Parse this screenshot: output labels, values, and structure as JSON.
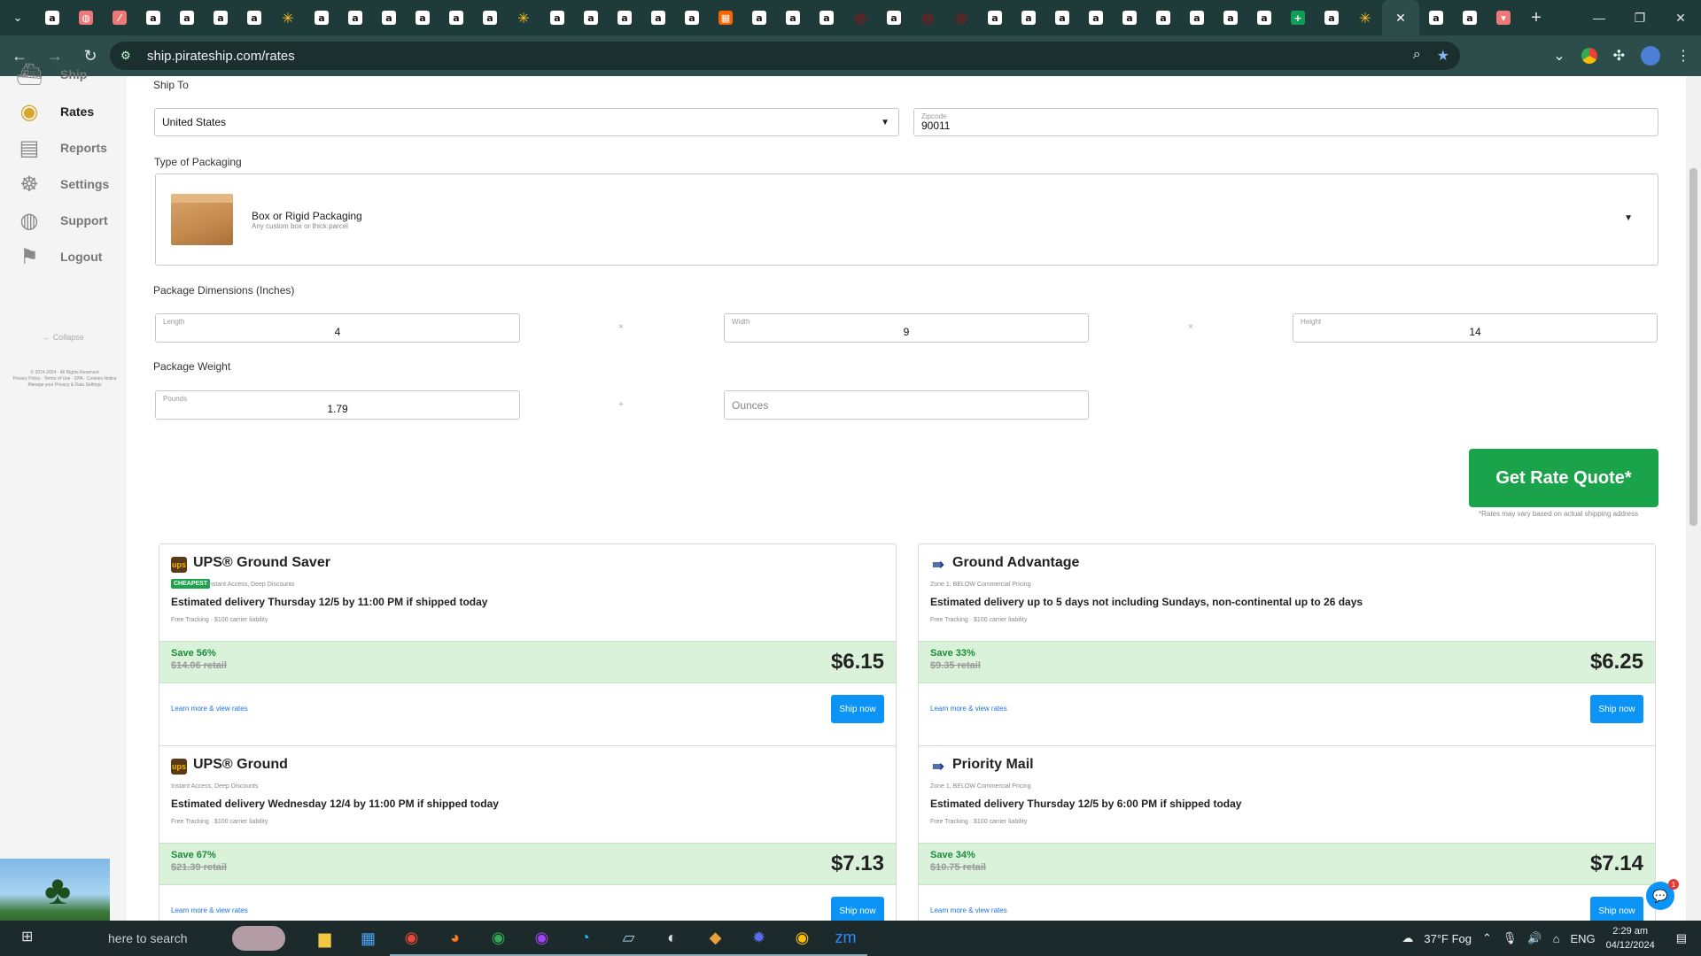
{
  "browser": {
    "tabs": [
      {
        "icon": "amazon-icon",
        "glyph": "a"
      },
      {
        "icon": "other-icon",
        "glyph": "◍"
      },
      {
        "icon": "other-icon",
        "glyph": "⁄"
      },
      {
        "icon": "amazon-icon",
        "glyph": "a"
      },
      {
        "icon": "amazon-icon",
        "glyph": "a"
      },
      {
        "icon": "amazon-icon",
        "glyph": "a"
      },
      {
        "icon": "amazon-icon",
        "glyph": "a"
      },
      {
        "icon": "walmart-icon",
        "glyph": "✳"
      },
      {
        "icon": "amazon-icon",
        "glyph": "a"
      },
      {
        "icon": "amazon-icon",
        "glyph": "a"
      },
      {
        "icon": "amazon-icon",
        "glyph": "a"
      },
      {
        "icon": "amazon-icon",
        "glyph": "a"
      },
      {
        "icon": "amazon-icon",
        "glyph": "a"
      },
      {
        "icon": "amazon-icon",
        "glyph": "a"
      },
      {
        "icon": "walmart-icon",
        "glyph": "✳"
      },
      {
        "icon": "amazon-icon",
        "glyph": "a"
      },
      {
        "icon": "amazon-icon",
        "glyph": "a"
      },
      {
        "icon": "amazon-icon",
        "glyph": "a"
      },
      {
        "icon": "amazon-icon",
        "glyph": "a"
      },
      {
        "icon": "amazon-icon",
        "glyph": "a"
      },
      {
        "icon": "home-depot-icon",
        "glyph": "▦"
      },
      {
        "icon": "amazon-icon",
        "glyph": "a"
      },
      {
        "icon": "amazon-icon",
        "glyph": "a"
      },
      {
        "icon": "amazon-icon",
        "glyph": "a"
      },
      {
        "icon": "target-icon",
        "glyph": "◎"
      },
      {
        "icon": "amazon-icon",
        "glyph": "a"
      },
      {
        "icon": "target-icon",
        "glyph": "◎"
      },
      {
        "icon": "target-icon",
        "glyph": "◎"
      },
      {
        "icon": "amazon-icon",
        "glyph": "a"
      },
      {
        "icon": "amazon-icon",
        "glyph": "a"
      },
      {
        "icon": "amazon-icon",
        "glyph": "a"
      },
      {
        "icon": "amazon-icon",
        "glyph": "a"
      },
      {
        "icon": "amazon-icon",
        "glyph": "a"
      },
      {
        "icon": "amazon-icon",
        "glyph": "a"
      },
      {
        "icon": "amazon-icon",
        "glyph": "a"
      },
      {
        "icon": "amazon-icon",
        "glyph": "a"
      },
      {
        "icon": "amazon-icon",
        "glyph": "a"
      },
      {
        "icon": "sheets-icon",
        "glyph": "+"
      },
      {
        "icon": "amazon-icon",
        "glyph": "a"
      },
      {
        "icon": "walmart-icon",
        "glyph": "✳"
      }
    ],
    "active_tab_close": "✕",
    "tabs_after": [
      {
        "icon": "amazon-icon",
        "glyph": "a"
      },
      {
        "icon": "amazon-icon",
        "glyph": "a"
      },
      {
        "icon": "other-icon",
        "glyph": "▾"
      }
    ],
    "new_tab": "+",
    "url": "ship.pirateship.com/rates"
  },
  "sidebar": {
    "items": [
      {
        "key": "ship",
        "label": "Ship",
        "icon": "ship-icon",
        "glyph": "⛴"
      },
      {
        "key": "rates",
        "label": "Rates",
        "icon": "coins-icon",
        "glyph": "◉"
      },
      {
        "key": "reports",
        "label": "Reports",
        "icon": "reports-icon",
        "glyph": "▤"
      },
      {
        "key": "settings",
        "label": "Settings",
        "icon": "helm-icon",
        "glyph": "☸"
      },
      {
        "key": "support",
        "label": "Support",
        "icon": "lifebuoy-icon",
        "glyph": "◍"
      },
      {
        "key": "logout",
        "label": "Logout",
        "icon": "logout-icon",
        "glyph": "⚑"
      }
    ],
    "collapse": "← Collapse",
    "legal_line1": "© 2014-2024 · All Rights Reserved",
    "legal_line2": "Privacy Policy · Terms of Use · DPA · Cookies Notice",
    "legal_line3": "Manage your Privacy & Data Settings"
  },
  "form": {
    "ship_to_label": "Ship To",
    "country": "United States",
    "zipcode_label": "Zipcode",
    "zipcode": "90011",
    "packaging_label": "Type of Packaging",
    "packaging_title": "Box or Rigid Packaging",
    "packaging_sub": "Any custom box or thick parcel",
    "dimensions_label": "Package Dimensions (Inches)",
    "length_label": "Length",
    "length": "4",
    "width_label": "Width",
    "width": "9",
    "height_label": "Height",
    "height": "14",
    "times": "×",
    "weight_label": "Package Weight",
    "pounds_label": "Pounds",
    "pounds": "1.79",
    "plus": "+",
    "ounces_placeholder": "Ounces",
    "quote_button": "Get Rate Quote*",
    "quote_note": "*Rates may vary based on actual shipping address"
  },
  "rates": [
    {
      "carrier": "ups",
      "service": "UPS® Ground Saver",
      "badge": "CHEAPEST",
      "tags": "Instant Access, Deep Discounts",
      "delivery": "Estimated delivery Thursday 12/5 by 11:00 PM if shipped today",
      "tracking": "Free Tracking · $100 carrier liability",
      "save": "Save 56%",
      "retail": "$14.06 retail",
      "price": "$6.15",
      "learn": "Learn more & view rates",
      "ship": "Ship now"
    },
    {
      "carrier": "usps",
      "service": "Ground Advantage",
      "badge": "",
      "tags": "Zone 1, BELOW Commercial Pricing",
      "delivery": "Estimated delivery up to 5 days not including Sundays, non-continental up to 26 days",
      "tracking": "Free Tracking · $100 carrier liability",
      "save": "Save 33%",
      "retail": "$9.35 retail",
      "price": "$6.25",
      "learn": "Learn more & view rates",
      "ship": "Ship now"
    },
    {
      "carrier": "ups",
      "service": "UPS® Ground",
      "badge": "",
      "tags": "Instant Access, Deep Discounts",
      "delivery": "Estimated delivery Wednesday 12/4 by 11:00 PM if shipped today",
      "tracking": "Free Tracking · $100 carrier liability",
      "save": "Save 67%",
      "retail": "$21.39 retail",
      "price": "$7.13",
      "learn": "Learn more & view rates",
      "ship": "Ship now"
    },
    {
      "carrier": "usps",
      "service": "Priority Mail",
      "badge": "",
      "tags": "Zone 1, BELOW Commercial Pricing",
      "delivery": "Estimated delivery Thursday 12/5 by 6:00 PM if shipped today",
      "tracking": "Free Tracking · $100 carrier liability",
      "save": "Save 34%",
      "retail": "$10.75 retail",
      "price": "$7.14",
      "learn": "Learn more & view rates",
      "ship": "Ship now"
    }
  ],
  "chat": {
    "badge": "1"
  },
  "taskbar": {
    "search_text": "here to search",
    "apps": [
      {
        "icon": "file-explorer-icon",
        "glyph": "▆",
        "color": "#f2c744"
      },
      {
        "icon": "store-icon",
        "glyph": "▦",
        "color": "#4aa3f0"
      },
      {
        "icon": "chrome-icon",
        "glyph": "◉",
        "color": "#e8493a"
      },
      {
        "icon": "firefox-icon",
        "glyph": "◕",
        "color": "#ff7a1a"
      },
      {
        "icon": "chrome-profile-icon",
        "glyph": "◉",
        "color": "#34a853"
      },
      {
        "icon": "chrome-profile2-icon",
        "glyph": "◉",
        "color": "#a142f4"
      },
      {
        "icon": "edge-icon",
        "glyph": "◔",
        "color": "#2bb3e8"
      },
      {
        "icon": "notepad-icon",
        "glyph": "▱",
        "color": "#9fd1e8"
      },
      {
        "icon": "app-icon",
        "glyph": "◐",
        "color": "#e0e0e0"
      },
      {
        "icon": "app2-icon",
        "glyph": "◆",
        "color": "#e6a13a"
      },
      {
        "icon": "app3-icon",
        "glyph": "✹",
        "color": "#5b6cf0"
      },
      {
        "icon": "chrome-active-icon",
        "glyph": "◉",
        "color": "#fbbc05"
      },
      {
        "icon": "zoom-icon",
        "glyph": "zm",
        "color": "#2d8cff"
      }
    ],
    "weather": "37°F  Fog",
    "lang": "ENG",
    "time": "2:29 am",
    "date": "04/12/2024"
  }
}
